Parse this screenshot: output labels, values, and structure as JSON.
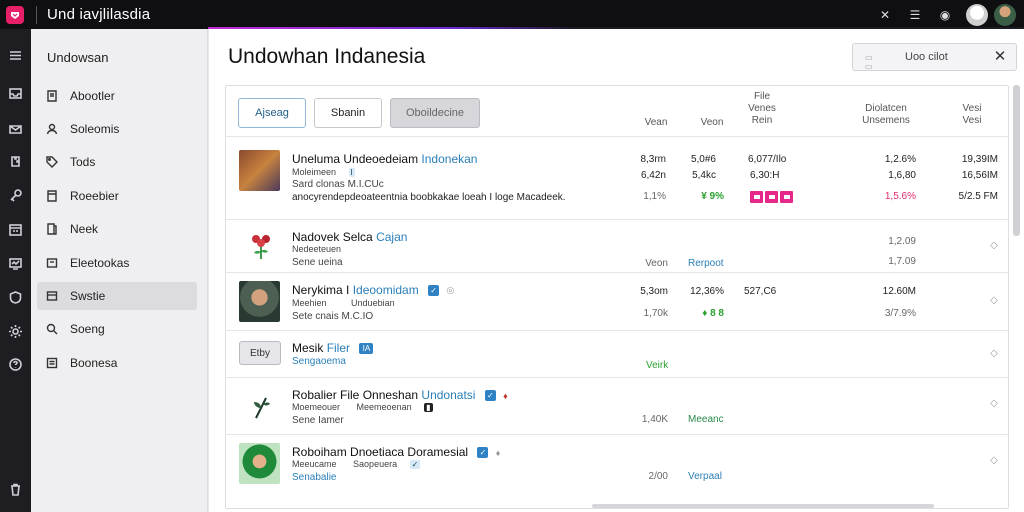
{
  "app": {
    "title": "Und iavjlilasdia"
  },
  "topbar_icons": [
    "x-icon",
    "list-icon",
    "bell-icon"
  ],
  "sidebar": {
    "title": "Undowsan",
    "items": [
      {
        "label": "Abootler",
        "icon": "home-icon"
      },
      {
        "label": "Soleomis",
        "icon": "user-icon"
      },
      {
        "label": "Tods",
        "icon": "tag-icon"
      },
      {
        "label": "Roeebier",
        "icon": "pin-icon"
      },
      {
        "label": "Neek",
        "icon": "book-icon"
      },
      {
        "label": "Eleetookas",
        "icon": "box-icon"
      },
      {
        "label": "Swstie",
        "icon": "window-icon",
        "active": true
      },
      {
        "label": "Soeng",
        "icon": "search-icon"
      },
      {
        "label": "Boonesa",
        "icon": "list-icon"
      }
    ]
  },
  "main": {
    "title": "Undowhan Indanesia",
    "search": {
      "value": "Uoo cilot"
    }
  },
  "toolbar": {
    "btn_a": "Ajseag",
    "btn_b": "Sbanin",
    "btn_c": "Oboildecine"
  },
  "columns": {
    "c1": "Vean",
    "c2": "Veon",
    "c3_line1": "File",
    "c3_line2": "Venes",
    "c3_line3": "Rein",
    "c4_line1": "Diolatcen",
    "c4_line2": "Unsemens",
    "c5_line1": "Vesi",
    "c5_line2": "Vesi"
  },
  "rows": [
    {
      "title": "Uneluma Undeoedeiam",
      "title_blue": "Indonekan",
      "sub1": "Moleimeen",
      "sub1_mark": "I",
      "sub2": "Sard clonas M.I.CUc",
      "sub3": "anocyrendepdeoateentnia boobkakae loeah I loge Macadeek.",
      "v1": "8,3rm",
      "v2": "5,0#6",
      "v3": "6,077/Ilo",
      "v4": "1,2.6%",
      "v5": "19,39IM",
      "v1b": "6,42n",
      "v2b": "5,4kc",
      "v3b": "6,30:H",
      "v4b": "1,6,80",
      "v5b": "16,56IM",
      "v1c": "1,1%",
      "v2c": "¥ 9%",
      "v4c": "1,5.6%",
      "v5c": "5/2.5 FM"
    },
    {
      "title": "Nadovek Selca",
      "title_blue": "Cajan",
      "sub1": "Nedeeteuen",
      "sub2": "Sene ueina",
      "v_grey": "Veon",
      "v_blue": "Rerpoot",
      "v4": "1,2.09",
      "v4b": "1,7.09"
    },
    {
      "title": "Nerykima I",
      "title_blue": "Ideoomidam",
      "sub1": "Meehien",
      "sub1_mid": "Unduebian",
      "sub2": "Sete cnais M.C.IO",
      "v1": "5,3om",
      "v2": "12,36%",
      "v3": "527,C6",
      "v4": "12.60M",
      "v1b": "1,70k",
      "v2b": "♦ 8 8",
      "v4b": "3/7.9%"
    },
    {
      "label_btn": "Etby",
      "title": "Mesik",
      "title_blue": "Filer",
      "title_mark": "IA",
      "sub2": "Sengaoema",
      "v_green": "Veirk"
    },
    {
      "title": "Robalier File Onneshan",
      "title_blue": "Undonatsi",
      "sub1": "Moemeouer",
      "sub1_mid": "Meemeoenan",
      "sub2": "Sene Iamer",
      "v1": "1,40K",
      "v_green": "Meeanc"
    },
    {
      "title": "Roboiham Dnoetiaca Doramesial",
      "sub1": "Meeucame",
      "sub1_mid": "Saopeuera",
      "sub2": "Senabalie",
      "v1": "2/00",
      "v_blue": "Verpaal"
    }
  ]
}
